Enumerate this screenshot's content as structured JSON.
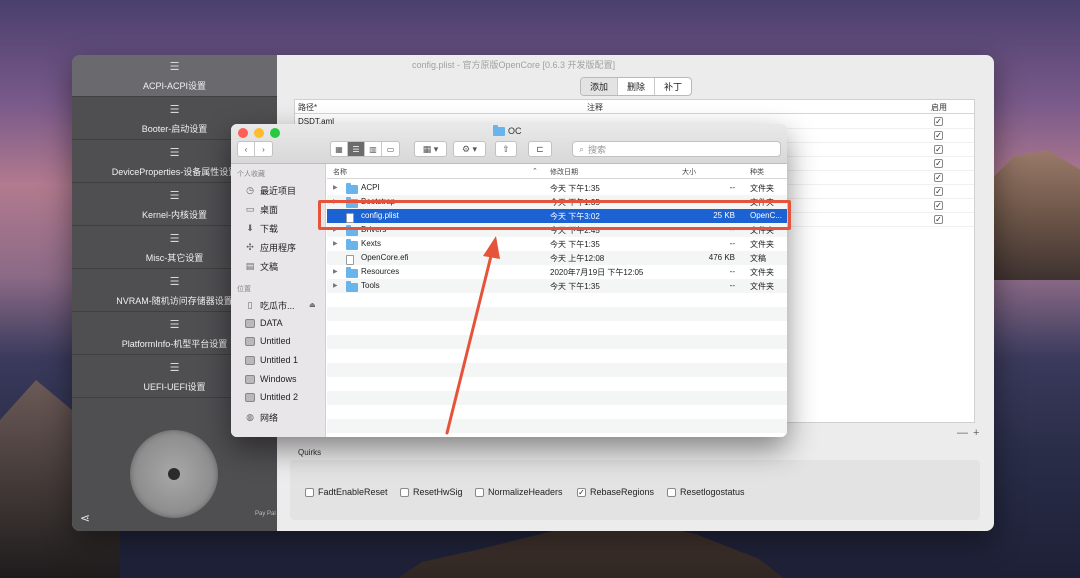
{
  "app": {
    "title": "config.plist - 官方原版OpenCore [0.6.3 开发版配置]",
    "sidebar": [
      {
        "label": "ACPI-ACPI设置",
        "active": true
      },
      {
        "label": "Booter-启动设置"
      },
      {
        "label": "DeviceProperties-设备属性设置"
      },
      {
        "label": "Kernel-内核设置"
      },
      {
        "label": "Misc-其它设置"
      },
      {
        "label": "NVRAM-随机访问存储器设置"
      },
      {
        "label": "PlatformInfo-机型平台设置"
      },
      {
        "label": "UEFI-UEFI设置"
      }
    ],
    "dial_text": "Pay Pal",
    "tabs": [
      "添加",
      "删除",
      "补丁"
    ],
    "active_tab": "添加",
    "table": {
      "headers": {
        "path": "路径*",
        "comment": "注释",
        "enabled": "启用"
      },
      "first_row_path": "DSDT.aml",
      "checked_rows": 8
    },
    "plus_minus": "— +",
    "quirks": {
      "label": "Quirks",
      "items": [
        {
          "label": "FadtEnableReset",
          "checked": false
        },
        {
          "label": "ResetHwSig",
          "checked": false
        },
        {
          "label": "NormalizeHeaders",
          "checked": false
        },
        {
          "label": "RebaseRegions",
          "checked": true
        },
        {
          "label": "Resetlogostatus",
          "checked": false
        }
      ]
    }
  },
  "finder": {
    "title": "OC",
    "search_placeholder": "搜索",
    "sidebar": {
      "favorites_label": "个人收藏",
      "favorites": [
        {
          "label": "最近项目",
          "icon": "clock-icon"
        },
        {
          "label": "桌面",
          "icon": "desktop-icon"
        },
        {
          "label": "下载",
          "icon": "download-icon"
        },
        {
          "label": "应用程序",
          "icon": "applications-icon"
        },
        {
          "label": "文稿",
          "icon": "document-icon"
        }
      ],
      "locations_label": "位置",
      "locations": [
        "吃瓜市...",
        "DATA",
        "Untitled",
        "Untitled 1",
        "Windows",
        "Untitled 2",
        "网络"
      ]
    },
    "columns": {
      "name": "名称",
      "date": "修改日期",
      "size": "大小",
      "kind": "种类"
    },
    "rows": [
      {
        "name": "ACPI",
        "date": "今天 下午1:35",
        "size": "--",
        "kind": "文件夹",
        "folder": true
      },
      {
        "name": "Bootstrap",
        "date": "今天 下午1:35",
        "size": "--",
        "kind": "文件夹",
        "folder": true
      },
      {
        "name": "config.plist",
        "date": "今天 下午3:02",
        "size": "25 KB",
        "kind": "OpenC...",
        "folder": false,
        "selected": true
      },
      {
        "name": "Drivers",
        "date": "今天 下午2:45",
        "size": "--",
        "kind": "文件夹",
        "folder": true
      },
      {
        "name": "Kexts",
        "date": "今天 下午1:35",
        "size": "--",
        "kind": "文件夹",
        "folder": true
      },
      {
        "name": "OpenCore.efi",
        "date": "今天 上午12:08",
        "size": "476 KB",
        "kind": "文稿",
        "folder": false
      },
      {
        "name": "Resources",
        "date": "2020年7月19日 下午12:05",
        "size": "--",
        "kind": "文件夹",
        "folder": true
      },
      {
        "name": "Tools",
        "date": "今天 下午1:35",
        "size": "--",
        "kind": "文件夹",
        "folder": true
      }
    ]
  },
  "colors": {
    "highlight": "#e5543a",
    "selection": "#1d62d2",
    "folder": "#69b4ea",
    "sidebar_dark": "#4f4f52"
  }
}
